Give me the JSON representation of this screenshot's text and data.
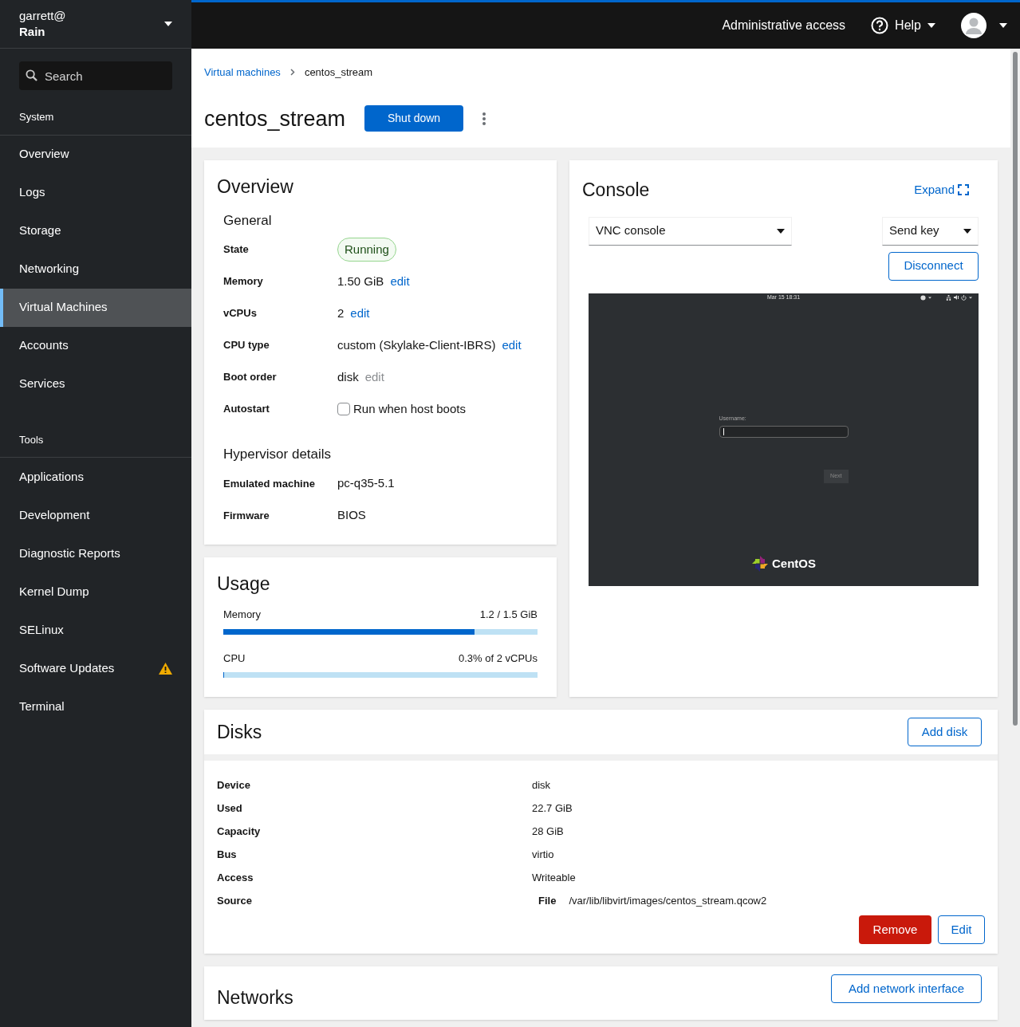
{
  "sidebar": {
    "user": "garrett@",
    "host": "Rain",
    "search": {
      "placeholder": "Search"
    },
    "sections": [
      {
        "title": "System",
        "items": [
          {
            "label": "Overview",
            "selected": false
          },
          {
            "label": "Logs",
            "selected": false
          },
          {
            "label": "Storage",
            "selected": false
          },
          {
            "label": "Networking",
            "selected": false
          },
          {
            "label": "Virtual Machines",
            "selected": true
          },
          {
            "label": "Accounts",
            "selected": false
          },
          {
            "label": "Services",
            "selected": false
          }
        ]
      },
      {
        "title": "Tools",
        "items": [
          {
            "label": "Applications",
            "selected": false
          },
          {
            "label": "Development",
            "selected": false
          },
          {
            "label": "Diagnostic Reports",
            "selected": false
          },
          {
            "label": "Kernel Dump",
            "selected": false
          },
          {
            "label": "SELinux",
            "selected": false
          },
          {
            "label": "Software Updates",
            "selected": false,
            "warning": true
          },
          {
            "label": "Terminal",
            "selected": false
          }
        ]
      }
    ]
  },
  "topbar": {
    "admin": "Administrative access",
    "help": "Help"
  },
  "breadcrumb": [
    "Virtual machines",
    "centos_stream"
  ],
  "title": "centos_stream",
  "shutdown": "Shut down",
  "overview": {
    "title": "Overview",
    "general": "General",
    "rows": [
      {
        "kind": "badge",
        "label": "State",
        "value": "Running"
      },
      {
        "kind": "edit",
        "label": "Memory",
        "value": "1.50 GiB",
        "edit": "edit",
        "disabled": false
      },
      {
        "kind": "edit",
        "label": "vCPUs",
        "value": "2",
        "edit": "edit",
        "disabled": false
      },
      {
        "kind": "edit",
        "label": "CPU type",
        "value": "custom (Skylake-Client-IBRS)",
        "edit": "edit",
        "disabled": false
      },
      {
        "kind": "edit",
        "label": "Boot order",
        "value": "disk",
        "edit": "edit",
        "disabled": true
      },
      {
        "kind": "checkbox",
        "label": "Autostart",
        "value": "Run when host boots",
        "checked": false
      }
    ],
    "hypervisor": "Hypervisor details",
    "hrows": [
      {
        "label": "Emulated machine",
        "value": "pc-q35-5.1"
      },
      {
        "label": "Firmware",
        "value": "BIOS"
      }
    ]
  },
  "usage": {
    "title": "Usage",
    "meters": [
      {
        "label": "Memory",
        "reading": "1.2 / 1.5 GiB",
        "level": 0.8
      },
      {
        "label": "CPU",
        "reading": "0.3% of 2 vCPUs",
        "level": 0.003
      }
    ]
  },
  "console": {
    "title": "Console",
    "expand": "Expand",
    "type": "VNC console",
    "sendkey": "Send key",
    "disconnect": "Disconnect",
    "screen": {
      "clock": "Mar 15 18:31",
      "username": "Username:",
      "next": "Next",
      "logo": "CentOS"
    }
  },
  "disks": {
    "title": "Disks",
    "add": "Add disk",
    "rows": [
      {
        "label": "Device",
        "value": "disk"
      },
      {
        "label": "Used",
        "value": "22.7 GiB"
      },
      {
        "label": "Capacity",
        "value": "28 GiB"
      },
      {
        "label": "Bus",
        "value": "virtio"
      },
      {
        "label": "Access",
        "value": "Writeable"
      },
      {
        "label": "Source",
        "sublabel": "File",
        "value": "/var/lib/libvirt/images/centos_stream.qcow2"
      }
    ],
    "remove": "Remove",
    "edit": "Edit"
  },
  "networks": {
    "title": "Networks",
    "add": "Add network interface"
  }
}
